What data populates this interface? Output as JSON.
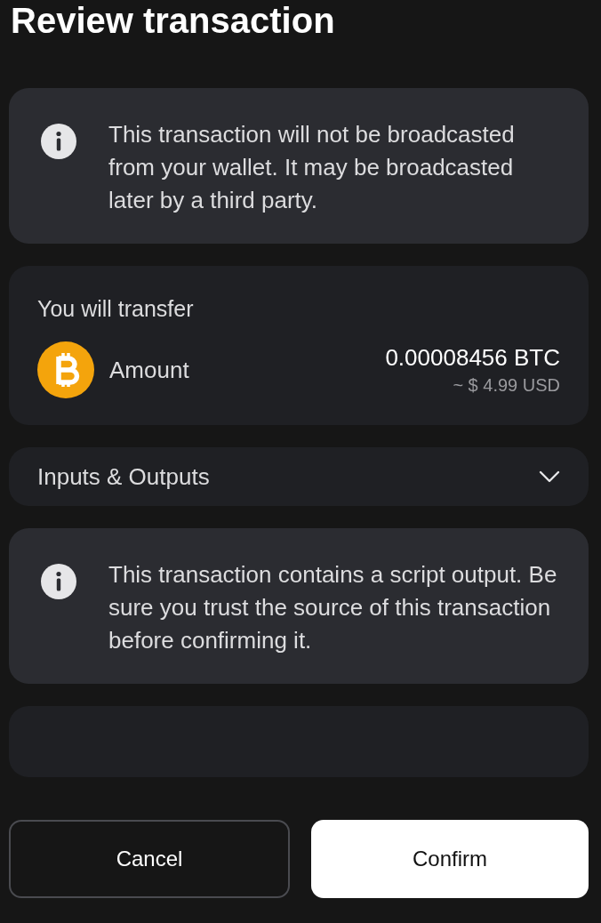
{
  "title": "Review transaction",
  "sections": [
    {
      "kind": "notice",
      "text": "This transaction will not be broadcasted from your wallet. It may be broadcasted later by a third party."
    },
    {
      "kind": "transfer",
      "heading": "You will transfer",
      "label": "Amount",
      "amount": "0.00008456 BTC",
      "fiat": "~ $ 4.99 USD"
    },
    {
      "kind": "expander",
      "label": "Inputs & Outputs",
      "expanded": false
    },
    {
      "kind": "notice",
      "text": "This transaction contains a script output. Be sure you trust the source of this transaction before confirming it."
    },
    {
      "kind": "blank"
    }
  ],
  "buttons": [
    {
      "label": "Cancel",
      "kind": "secondary"
    },
    {
      "label": "Confirm",
      "kind": "primary"
    }
  ]
}
